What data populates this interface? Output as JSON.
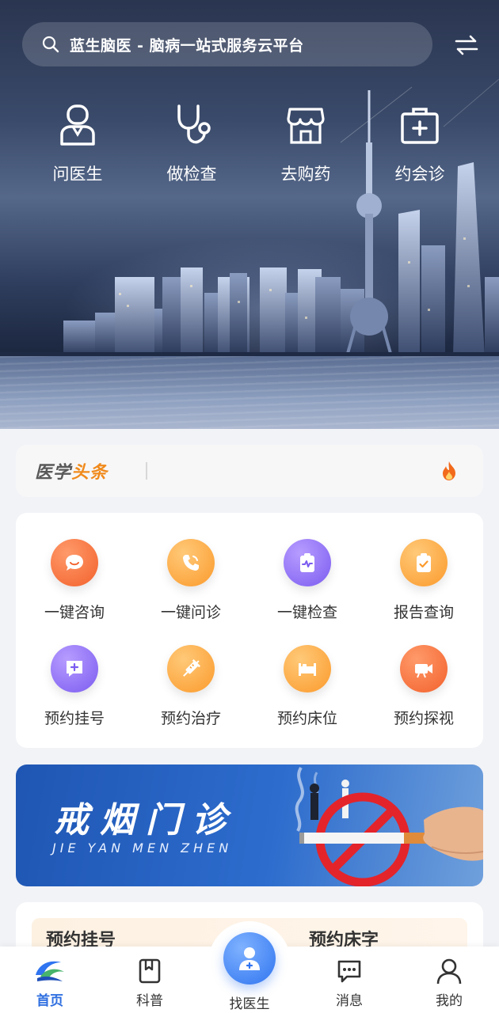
{
  "search": {
    "text": "蓝生脑医 - 脑病一站式服务云平台"
  },
  "quick_entries": [
    {
      "label": "问医生",
      "icon": "doctor-icon"
    },
    {
      "label": "做检查",
      "icon": "stethoscope-icon"
    },
    {
      "label": "去购药",
      "icon": "pharmacy-store-icon"
    },
    {
      "label": "约会诊",
      "icon": "medical-kit-icon"
    }
  ],
  "headline": {
    "logo_part1": "医学",
    "logo_part2": "头条",
    "icon": "fire-icon"
  },
  "services": [
    {
      "label": "一键咨询",
      "icon": "chat-bubble-icon",
      "color": "#f2612c"
    },
    {
      "label": "一键问诊",
      "icon": "phone-icon",
      "color": "#fb9a2c"
    },
    {
      "label": "一键检查",
      "icon": "clipboard-pulse-icon",
      "color": "#7b5cf0"
    },
    {
      "label": "报告查询",
      "icon": "clipboard-check-icon",
      "color": "#fb9a2c"
    },
    {
      "label": "预约挂号",
      "icon": "add-message-icon",
      "color": "#7b5cf0"
    },
    {
      "label": "预约治疗",
      "icon": "syringe-icon",
      "color": "#fb9a2c"
    },
    {
      "label": "预约床位",
      "icon": "bed-icon",
      "color": "#fb9a2c"
    },
    {
      "label": "预约探视",
      "icon": "video-camera-icon",
      "color": "#f2612c"
    }
  ],
  "banner": {
    "title": "戒烟门诊",
    "subtitle": "JIE YAN MEN ZHEN"
  },
  "next_card": {
    "left_title": "预约挂号",
    "right_title": "预约床字"
  },
  "tabs": [
    {
      "label": "首页",
      "icon": "home-logo-icon",
      "active": true
    },
    {
      "label": "科普",
      "icon": "book-icon",
      "active": false
    },
    {
      "label": "找医生",
      "icon": "find-doctor-icon",
      "active": false
    },
    {
      "label": "消息",
      "icon": "message-icon",
      "active": false
    },
    {
      "label": "我的",
      "icon": "user-icon",
      "active": false
    }
  ],
  "colors": {
    "accent": "#2f6fe0",
    "headline_orange": "#f08a1c",
    "banner_blue": "#1f56b3"
  }
}
